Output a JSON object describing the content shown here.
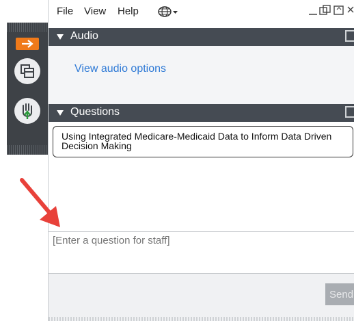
{
  "menubar": {
    "items": [
      "File",
      "View",
      "Help"
    ],
    "globe_icon": "globe-icon",
    "window_controls": [
      "minimize-icon",
      "restore-icon",
      "maximize-icon",
      "close-icon"
    ]
  },
  "dock": {
    "buttons": [
      "collapse-arrow-icon",
      "screen-share-icon",
      "raise-hand-icon"
    ]
  },
  "audio": {
    "header": "Audio",
    "link": "View audio options"
  },
  "questions": {
    "header": "Questions",
    "session_title": "Using Integrated Medicare-Medicaid Data to Inform Data Driven Decision Making",
    "input_placeholder": "[Enter a question for staff]",
    "send_label": "Send"
  },
  "colors": {
    "dock_bg": "#3e4247",
    "header_bg": "#454b53",
    "accent_orange": "#f07a1a",
    "link_blue": "#2f7ad6",
    "annotation_red": "#e8413a"
  }
}
